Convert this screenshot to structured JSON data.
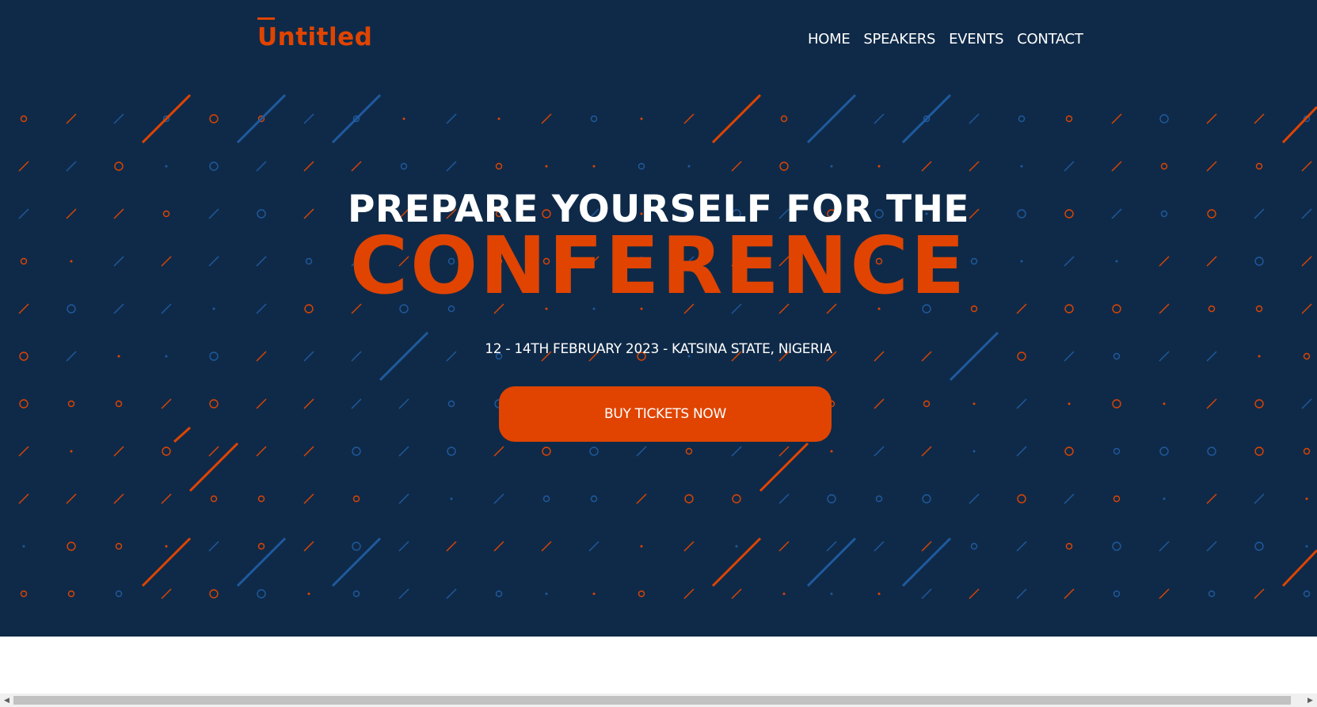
{
  "brand": {
    "name": "Untitled"
  },
  "nav": {
    "items": [
      "HOME",
      "SPEAKERS",
      "EVENTS",
      "CONTACT"
    ]
  },
  "hero": {
    "headline": "PREPARE YOURSELF FOR THE",
    "title": "CONFERENCE",
    "date_location": "12 - 14TH FEBRUARY 2023 - KATSINA STATE, NIGERIA",
    "cta_label": "BUY TICKETS NOW"
  },
  "colors": {
    "background": "#0f2a48",
    "accent": "#e04400",
    "pattern_blue": "#1f5a9e",
    "text": "#ffffff"
  },
  "scrollbar": {
    "left_icon": "arrow-left-icon",
    "right_icon": "arrow-right-icon"
  }
}
